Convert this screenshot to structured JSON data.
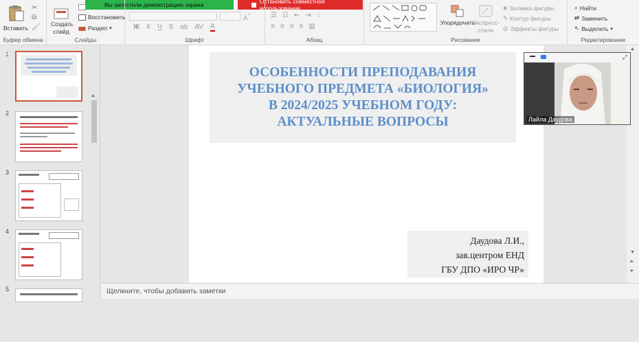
{
  "share": {
    "status_text": "Вы запустили демонстрацию экрана",
    "stop_label": "Остановить совместное использование"
  },
  "ribbon": {
    "clipboard": {
      "paste": "Вставить",
      "label": "Буфер обмена"
    },
    "slides": {
      "new_slide": "Создать слайд",
      "reset": "Восстановить",
      "section": "Раздел",
      "label": "Слайды"
    },
    "font": {
      "bold": "Ж",
      "italic": "К",
      "underline": "Ч",
      "strike": "S",
      "case": "аb",
      "spacing": "AV",
      "label": "Шрифт"
    },
    "paragraph": {
      "label": "Абзац"
    },
    "drawing": {
      "arrange": "Упорядочить",
      "quick_styles": "Экспресс-стили",
      "fill": "Заливка фигуры",
      "outline": "Контур фигуры",
      "effects": "Эффекты фигуры",
      "label": "Рисование"
    },
    "editing": {
      "find": "Найти",
      "replace": "Заменить",
      "select": "Выделить",
      "label": "Редактирование"
    }
  },
  "thumbnails": [
    {
      "number": "1",
      "selected": true
    },
    {
      "number": "2",
      "selected": false
    },
    {
      "number": "3",
      "selected": false
    },
    {
      "number": "4",
      "selected": false
    },
    {
      "number": "5",
      "selected": false
    }
  ],
  "slide": {
    "title_lines": [
      "ОСОБЕННОСТИ ПРЕПОДАВАНИЯ",
      "УЧЕБНОГО ПРЕДМЕТА «БИОЛОГИЯ»",
      "В 2024/2025 УЧЕБНОМ ГОДУ:",
      "АКТУАЛЬНЫЕ ВОПРОСЫ"
    ],
    "author_lines": [
      "Даудова Л.И.,",
      "зав.центром ЕНД",
      "ГБУ ДПО «ИРО ЧР»"
    ]
  },
  "notes_placeholder": "Щелкните, чтобы добавить заметки",
  "video": {
    "participant_name": "Лайла Даудова"
  },
  "colors": {
    "title_blue": "#5d8fc9",
    "share_green": "#2cb34a",
    "share_red": "#e02b2b",
    "selected_thumb": "#c55a3c"
  }
}
